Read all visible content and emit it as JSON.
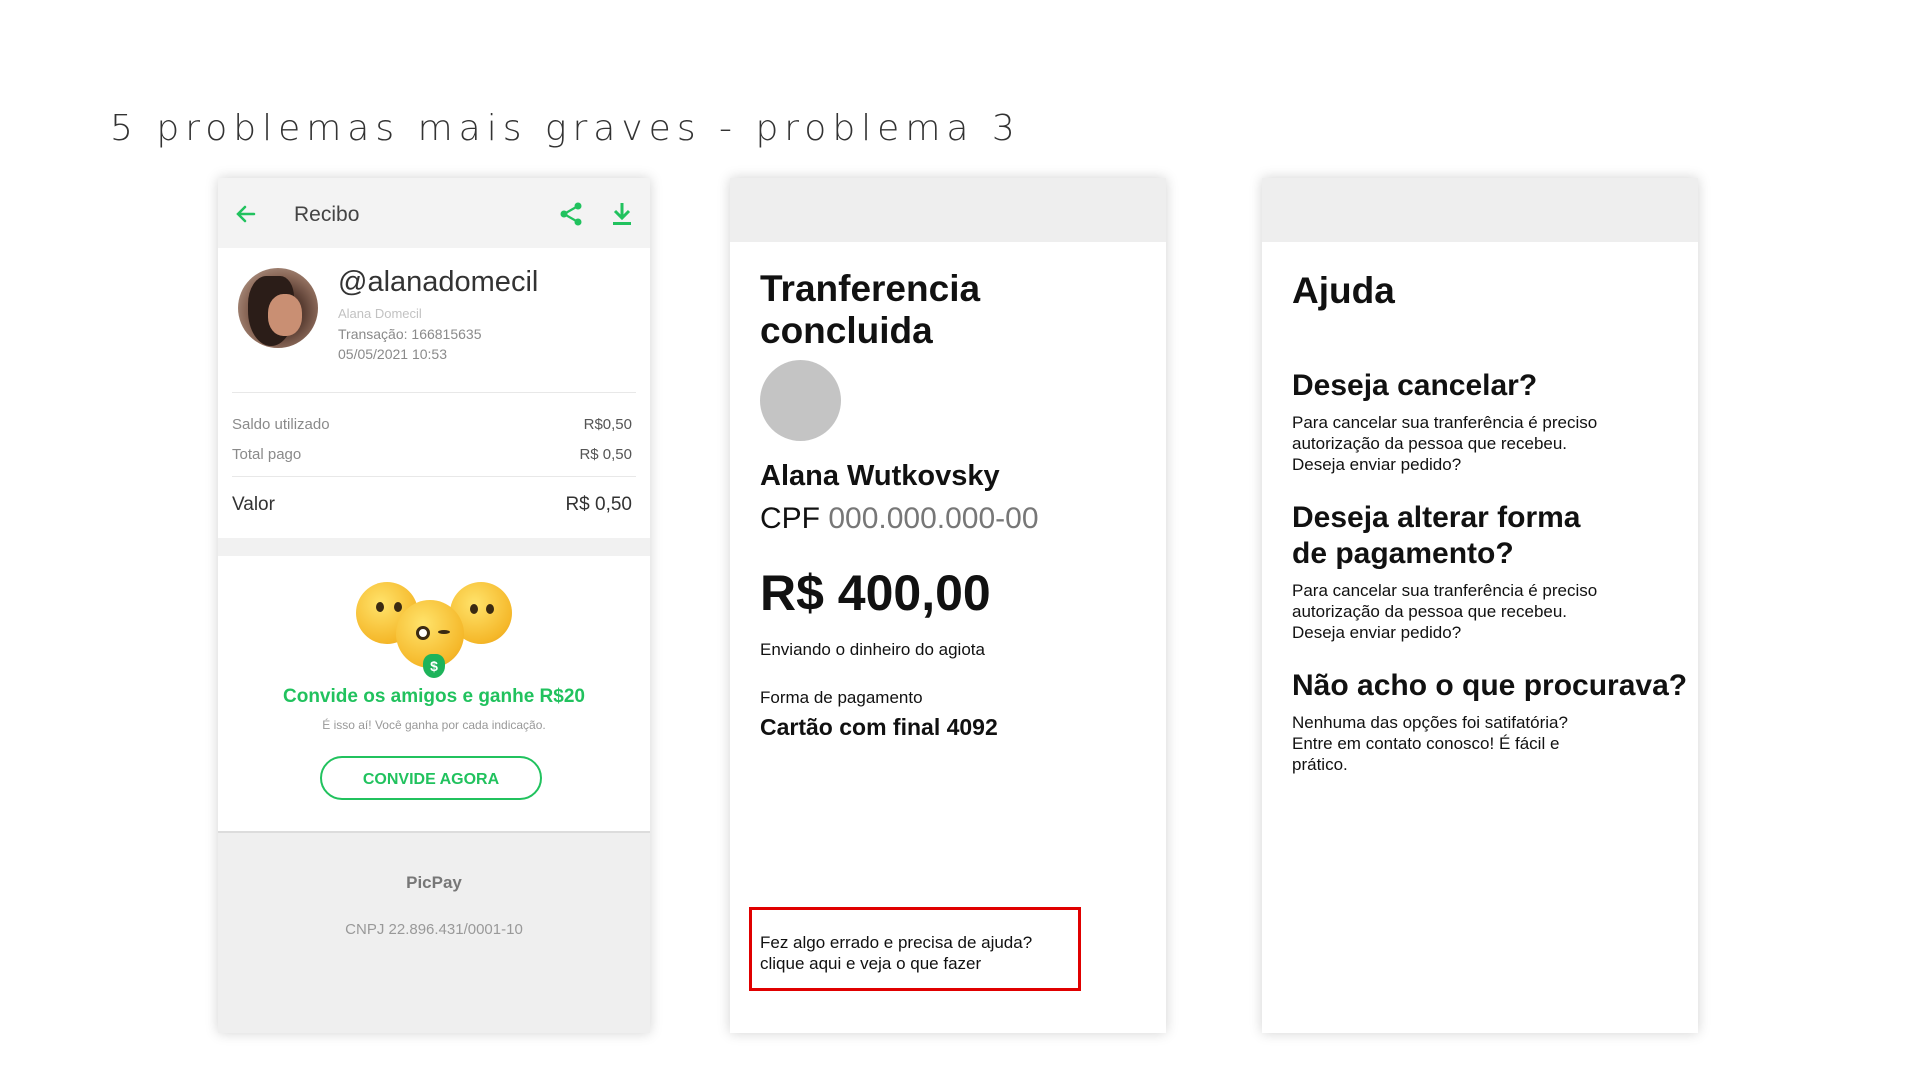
{
  "slide": {
    "title": "5 problemas mais graves - problema 3"
  },
  "receipt": {
    "header_title": "Recibo",
    "username": "@alanadomecil",
    "real_name": "Alana Domecil",
    "transaction": "Transação: 166815635",
    "datetime": "05/05/2021 10:53",
    "rows": [
      {
        "label": "Saldo utilizado",
        "value": "R$0,50"
      },
      {
        "label": "Total pago",
        "value": "R$ 0,50"
      }
    ],
    "valor_label": "Valor",
    "valor_value": "R$ 0,50",
    "invite": {
      "title": "Convide os amigos e ganhe R$20",
      "subtitle": "É isso aí! Você ganha por cada indicação.",
      "button": "CONVIDE AGORA",
      "tongue_symbol": "$"
    },
    "footer": {
      "brand": "PicPay",
      "cnpj": "CNPJ 22.896.431/0001-10"
    },
    "accent_color": "#21c25e"
  },
  "transfer": {
    "heading": "Tranferencia concluida",
    "recipient_name": "Alana Wutkovsky",
    "cpf_label": "CPF",
    "cpf_value": "000.000.000-00",
    "amount": "R$ 400,00",
    "description": "Enviando o dinheiro do agiota",
    "payment_label": "Forma de pagamento",
    "payment_value": "Cartão com final 4092",
    "help_line1": "Fez algo errado e precisa de ajuda?",
    "help_line2": "clique aqui e veja o que fazer",
    "highlight_color": "#e00000"
  },
  "help": {
    "title": "Ajuda",
    "sections": [
      {
        "question": "Deseja cancelar?",
        "answer": "Para cancelar sua tranferência é preciso autorização da pessoa que recebeu. Deseja enviar pedido?"
      },
      {
        "question": "Deseja alterar forma de pagamento?",
        "answer": "Para cancelar sua tranferência é preciso autorização da pessoa que recebeu. Deseja enviar pedido?"
      },
      {
        "question": "Não acho o que procurava?",
        "answer": "Nenhuma das opções foi satifatória? Entre em contato conosco! É fácil e prático."
      }
    ]
  }
}
